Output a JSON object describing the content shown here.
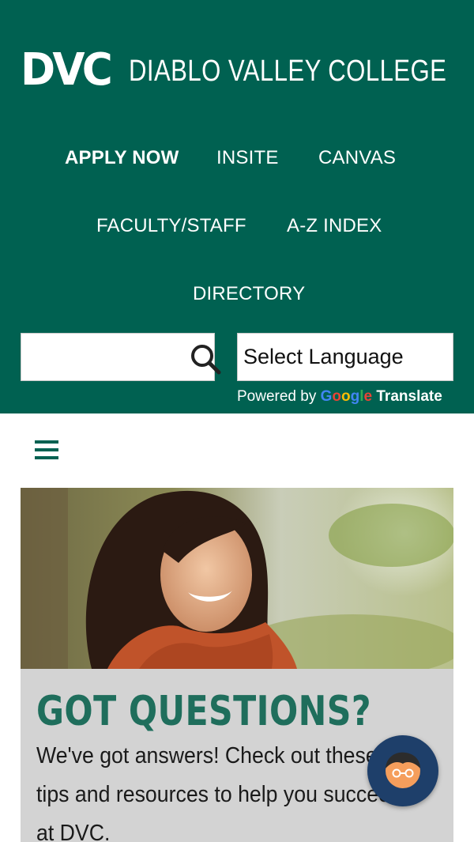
{
  "logo": {
    "mark": "DVC",
    "name": "DIABLO VALLEY COLLEGE"
  },
  "nav": {
    "items": [
      {
        "label": "APPLY NOW"
      },
      {
        "label": "INSITE"
      },
      {
        "label": "CANVAS"
      },
      {
        "label": "FACULTY/STAFF"
      },
      {
        "label": "A-Z INDEX"
      },
      {
        "label": "DIRECTORY"
      }
    ]
  },
  "search": {
    "value": "",
    "icon": "search-icon"
  },
  "language": {
    "selected": "Select Language"
  },
  "translate": {
    "powered_by": "Powered by",
    "google_letters": [
      "G",
      "o",
      "o",
      "g",
      "l",
      "e"
    ],
    "translate_label": "Translate"
  },
  "menu": {
    "icon": "hamburger-menu-icon"
  },
  "card": {
    "title": "GOT QUESTIONS?",
    "text": "We've got answers! Check out these tips and resources to help you succeed at DVC."
  },
  "chat": {
    "icon": "chat-avatar-icon"
  },
  "colors": {
    "brand_green": "#006151",
    "title_green": "#1f6e5c",
    "card_gray": "#d3d3d3",
    "chat_navy": "#1e3f6a",
    "avatar_orange": "#f59e5c"
  }
}
